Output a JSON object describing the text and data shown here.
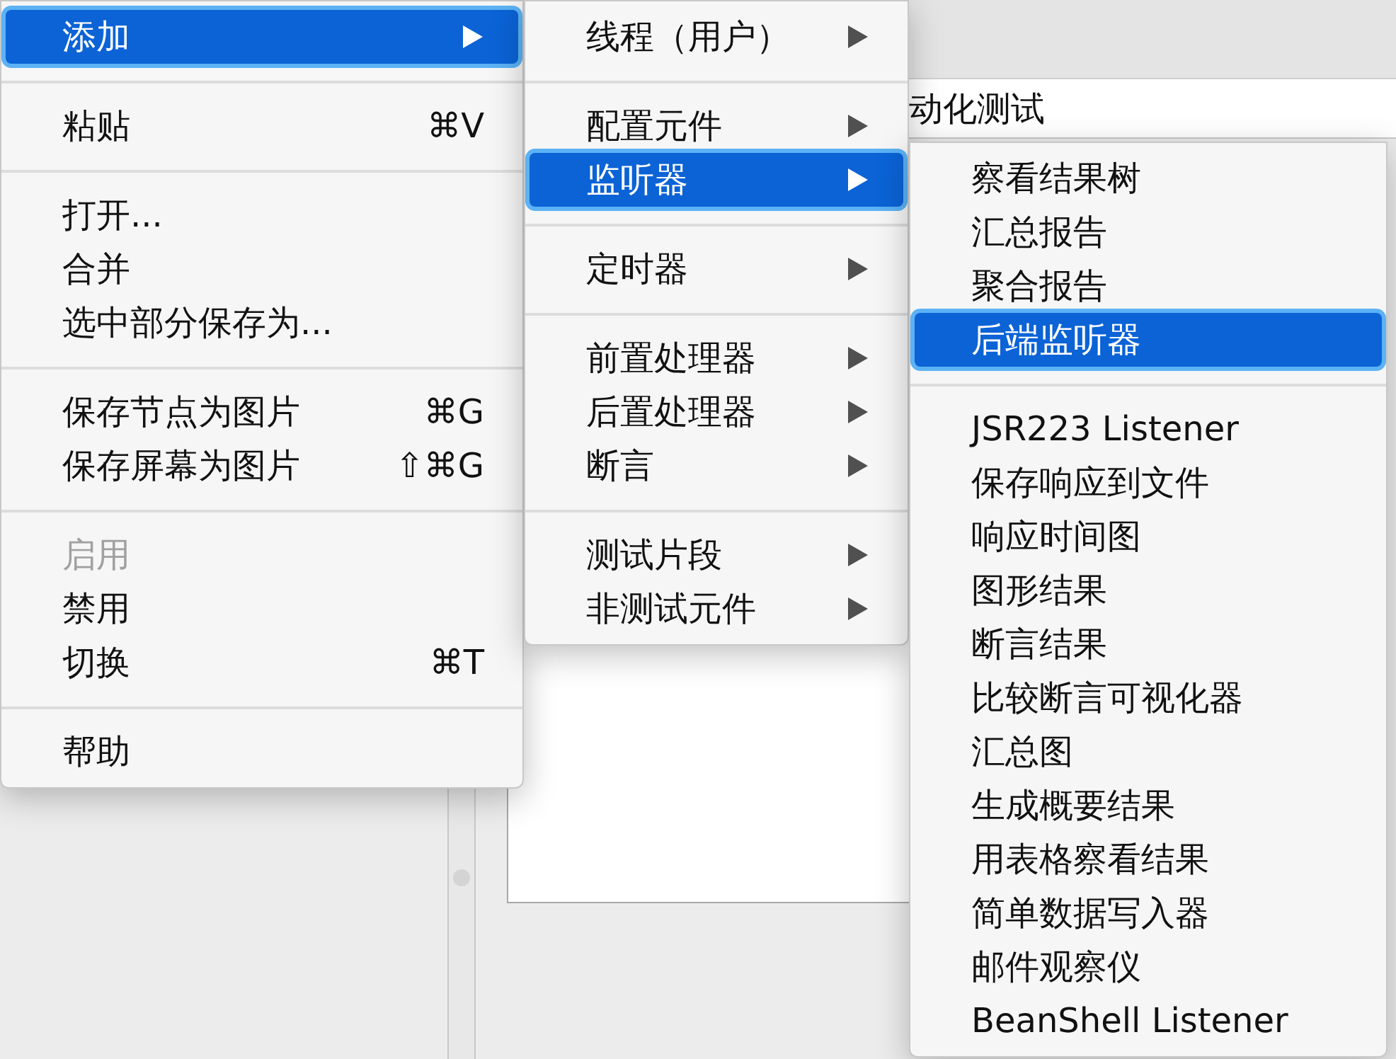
{
  "background": {
    "name_field": {
      "value": "动化测试"
    }
  },
  "menus": [
    {
      "items": [
        {
          "kind": "item",
          "label": "添加",
          "has_submenu": true,
          "selected": true,
          "disabled": false
        },
        {
          "kind": "separator"
        },
        {
          "kind": "item",
          "label": "粘贴",
          "shortcut": "⌘V",
          "has_submenu": false,
          "selected": false,
          "disabled": false
        },
        {
          "kind": "separator"
        },
        {
          "kind": "item",
          "label": "打开...",
          "has_submenu": false,
          "selected": false,
          "disabled": false
        },
        {
          "kind": "item",
          "label": "合并",
          "has_submenu": false,
          "selected": false,
          "disabled": false
        },
        {
          "kind": "item",
          "label": "选中部分保存为...",
          "has_submenu": false,
          "selected": false,
          "disabled": false
        },
        {
          "kind": "separator"
        },
        {
          "kind": "item",
          "label": "保存节点为图片",
          "shortcut": "⌘G",
          "has_submenu": false,
          "selected": false,
          "disabled": false
        },
        {
          "kind": "item",
          "label": "保存屏幕为图片",
          "shortcut": "⇧⌘G",
          "has_submenu": false,
          "selected": false,
          "disabled": false
        },
        {
          "kind": "separator"
        },
        {
          "kind": "item",
          "label": "启用",
          "has_submenu": false,
          "selected": false,
          "disabled": true
        },
        {
          "kind": "item",
          "label": "禁用",
          "has_submenu": false,
          "selected": false,
          "disabled": false
        },
        {
          "kind": "item",
          "label": "切换",
          "shortcut": "⌘T",
          "has_submenu": false,
          "selected": false,
          "disabled": false
        },
        {
          "kind": "separator"
        },
        {
          "kind": "item",
          "label": "帮助",
          "has_submenu": false,
          "selected": false,
          "disabled": false
        }
      ]
    },
    {
      "items": [
        {
          "kind": "item",
          "label": "线程（用户）",
          "has_submenu": true,
          "selected": false,
          "disabled": false
        },
        {
          "kind": "separator"
        },
        {
          "kind": "item",
          "label": "配置元件",
          "has_submenu": true,
          "selected": false,
          "disabled": false
        },
        {
          "kind": "item",
          "label": "监听器",
          "has_submenu": true,
          "selected": true,
          "disabled": false
        },
        {
          "kind": "separator"
        },
        {
          "kind": "item",
          "label": "定时器",
          "has_submenu": true,
          "selected": false,
          "disabled": false
        },
        {
          "kind": "separator"
        },
        {
          "kind": "item",
          "label": "前置处理器",
          "has_submenu": true,
          "selected": false,
          "disabled": false
        },
        {
          "kind": "item",
          "label": "后置处理器",
          "has_submenu": true,
          "selected": false,
          "disabled": false
        },
        {
          "kind": "item",
          "label": "断言",
          "has_submenu": true,
          "selected": false,
          "disabled": false
        },
        {
          "kind": "separator"
        },
        {
          "kind": "item",
          "label": "测试片段",
          "has_submenu": true,
          "selected": false,
          "disabled": false
        },
        {
          "kind": "item",
          "label": "非测试元件",
          "has_submenu": true,
          "selected": false,
          "disabled": false
        }
      ]
    },
    {
      "items": [
        {
          "kind": "item",
          "label": "察看结果树",
          "has_submenu": false,
          "selected": false,
          "disabled": false
        },
        {
          "kind": "item",
          "label": "汇总报告",
          "has_submenu": false,
          "selected": false,
          "disabled": false
        },
        {
          "kind": "item",
          "label": "聚合报告",
          "has_submenu": false,
          "selected": false,
          "disabled": false
        },
        {
          "kind": "item",
          "label": "后端监听器",
          "has_submenu": false,
          "selected": true,
          "disabled": false
        },
        {
          "kind": "separator"
        },
        {
          "kind": "item",
          "label": "JSR223 Listener",
          "has_submenu": false,
          "selected": false,
          "disabled": false
        },
        {
          "kind": "item",
          "label": "保存响应到文件",
          "has_submenu": false,
          "selected": false,
          "disabled": false
        },
        {
          "kind": "item",
          "label": "响应时间图",
          "has_submenu": false,
          "selected": false,
          "disabled": false
        },
        {
          "kind": "item",
          "label": "图形结果",
          "has_submenu": false,
          "selected": false,
          "disabled": false
        },
        {
          "kind": "item",
          "label": "断言结果",
          "has_submenu": false,
          "selected": false,
          "disabled": false
        },
        {
          "kind": "item",
          "label": "比较断言可视化器",
          "has_submenu": false,
          "selected": false,
          "disabled": false
        },
        {
          "kind": "item",
          "label": "汇总图",
          "has_submenu": false,
          "selected": false,
          "disabled": false
        },
        {
          "kind": "item",
          "label": "生成概要结果",
          "has_submenu": false,
          "selected": false,
          "disabled": false
        },
        {
          "kind": "item",
          "label": "用表格察看结果",
          "has_submenu": false,
          "selected": false,
          "disabled": false
        },
        {
          "kind": "item",
          "label": "简单数据写入器",
          "has_submenu": false,
          "selected": false,
          "disabled": false
        },
        {
          "kind": "item",
          "label": "邮件观察仪",
          "has_submenu": false,
          "selected": false,
          "disabled": false
        },
        {
          "kind": "item",
          "label": "BeanShell Listener",
          "has_submenu": false,
          "selected": false,
          "disabled": false
        }
      ]
    }
  ]
}
